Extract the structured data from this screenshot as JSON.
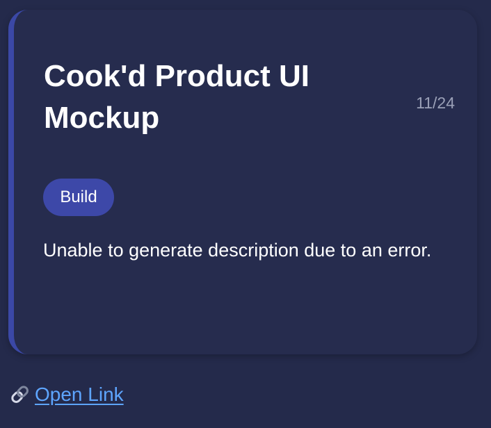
{
  "card": {
    "title": "Cook'd Product UI Mockup",
    "date": "11/24",
    "tag": "Build",
    "description": "Unable to generate description due to an error."
  },
  "link": {
    "icon": "link-icon",
    "label": "Open Link"
  },
  "colors": {
    "background": "#242a4b",
    "card": "#262c4e",
    "accent": "#3b48a6",
    "link": "#5ea5ff",
    "muted_text": "#9aa0b7"
  }
}
